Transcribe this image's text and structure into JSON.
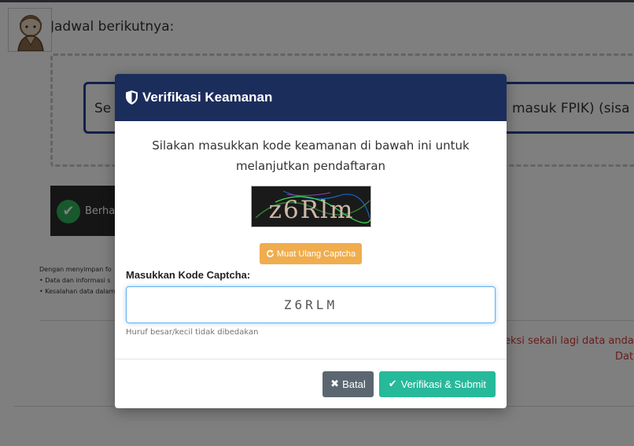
{
  "background": {
    "schedule_heading": "Jadwal berikutnya:",
    "info_text_left": "Se",
    "info_text_right": "masuk FPIK) (sisa",
    "success_text": "Berhas",
    "notes_intro": "Dengan menyimpan fo",
    "notes_item1": "• Data dan informasi s",
    "notes_item2": "• Kesalahan data dalam",
    "warning_line1": "eksi sekali lagi data anda se",
    "warning_line2": "Data"
  },
  "modal": {
    "title": "Verifikasi Keamanan",
    "instruction": "Silakan masukkan kode keamanan di bawah ini untuk melanjutkan pendaftaran",
    "captcha_text": "z6Rlm",
    "reload_label": "Muat Ulang Captcha",
    "input_label": "Masukkan Kode Captcha:",
    "input_value": "Z6RLM",
    "help_text": "Huruf besar/kecil tidak dibedakan",
    "cancel_label": "Batal",
    "submit_label": "Verifikasi & Submit"
  },
  "icons": {
    "header": "shield-icon",
    "reload": "refresh-icon",
    "cancel": "times-icon",
    "submit": "check-icon",
    "success": "check-circle-icon"
  },
  "colors": {
    "header_bg": "#1b2d5b",
    "reload_btn": "#f0ad4e",
    "cancel_btn": "#5b6670",
    "submit_btn": "#26b99a",
    "input_focus": "#66afe9",
    "warning_text": "#d23b3b",
    "info_border": "#22409a"
  }
}
